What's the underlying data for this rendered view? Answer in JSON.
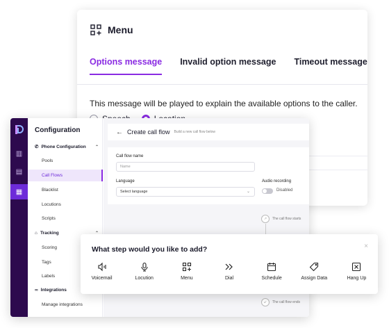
{
  "menu_card": {
    "title": "Menu",
    "tabs": [
      {
        "label": "Options message",
        "active": true
      },
      {
        "label": "Invalid option message",
        "active": false
      },
      {
        "label": "Timeout message",
        "active": false
      }
    ],
    "description": "This message will be played to explain the available options to the caller.",
    "radios": [
      {
        "label": "Speech",
        "checked": false
      },
      {
        "label": "Location",
        "checked": true
      }
    ]
  },
  "app": {
    "nav": {
      "title": "Configuration",
      "sections": [
        {
          "label": "Phone Configuration",
          "icon": "phone-icon",
          "items": [
            "Pools",
            "Call Flows",
            "Blacklist",
            "Locutions",
            "Scripts"
          ],
          "active_item": "Call Flows"
        },
        {
          "label": "Tracking",
          "icon": "tag-icon",
          "items": [
            "Scoring",
            "Tags",
            "Labels"
          ]
        },
        {
          "label": "Integrations",
          "icon": "link-icon",
          "items": [
            "Manage integrations"
          ]
        }
      ]
    },
    "header": {
      "title": "Create call flow",
      "subtitle": "Build a new call flow below"
    },
    "form": {
      "name_label": "Call flow name",
      "name_placeholder": "Name",
      "language_label": "Language",
      "language_value": "Select language",
      "recording_label": "Audio recording",
      "recording_state": "Disabled"
    },
    "flow": {
      "start_text": "The call flow starts",
      "end_text": "The call flow ends"
    }
  },
  "step_dialog": {
    "title": "What step would you like to add?",
    "close": "×",
    "options": [
      {
        "label": "Voicemail",
        "icon": "voicemail-icon"
      },
      {
        "label": "Locution",
        "icon": "microphone-icon"
      },
      {
        "label": "Menu",
        "icon": "menu-grid-icon"
      },
      {
        "label": "Dial",
        "icon": "dial-forward-icon"
      },
      {
        "label": "Schedule",
        "icon": "calendar-icon"
      },
      {
        "label": "Assign Data",
        "icon": "tag-icon"
      },
      {
        "label": "Hang Up",
        "icon": "hangup-icon"
      }
    ]
  },
  "colors": {
    "accent": "#8a2be2",
    "rail": "#2d0a4e"
  }
}
